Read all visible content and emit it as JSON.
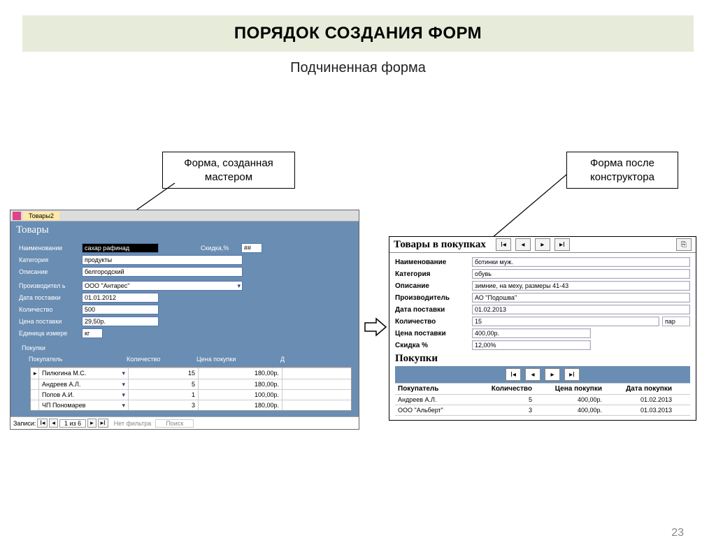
{
  "title": "ПОРЯДОК СОЗДАНИЯ ФОРМ",
  "subtitle": "Подчиненная форма",
  "callout_left": "Форма, созданная мастером",
  "callout_right": "Форма после конструктора",
  "page_number": "23",
  "left_form": {
    "tab": "Товары2",
    "header": "Товары",
    "fields": {
      "name_label": "Наименование",
      "name_value": "сахар рафинад",
      "cat_label": "Категория",
      "cat_value": "продукты",
      "desc_label": "Описание",
      "desc_value": "белгородский",
      "maker_label": "Производител ь",
      "maker_value": "ООО \"Антарес\"",
      "date_label": "Дата поставки",
      "date_value": "01.01.2012",
      "qty_label": "Количество",
      "qty_value": "500",
      "price_label": "Цена поставки",
      "price_value": "29,50р.",
      "unit_label": "Единица измере",
      "unit_value": "кг",
      "discount_label": "Скидка,%"
    },
    "sub_header": "Покупки",
    "columns": {
      "buyer": "Покупатель",
      "qty": "Количество",
      "price": "Цена покупки",
      "d": "Д"
    },
    "rows": [
      {
        "buyer": "Пилюгина М.С.",
        "qty": "15",
        "price": "180,00р."
      },
      {
        "buyer": "Андреев А.Л.",
        "qty": "5",
        "price": "180,00р."
      },
      {
        "buyer": "Попов А.И.",
        "qty": "1",
        "price": "100,00р."
      },
      {
        "buyer": "ЧП Пономарев",
        "qty": "3",
        "price": "180,00р."
      }
    ],
    "recnav": {
      "label": "Записи:",
      "pos": "1 из 6",
      "filter": "Нет фильтра",
      "search": "Поиск"
    }
  },
  "right_form": {
    "header": "Товары в покупках",
    "fields": {
      "name_label": "Наименование",
      "name_value": "ботинки муж.",
      "cat_label": "Категория",
      "cat_value": "обувь",
      "desc_label": "Описание",
      "desc_value": "зимние, на меху, размеры 41-43",
      "maker_label": "Производитель",
      "maker_value": "АО \"Подошва\"",
      "date_label": "Дата поставки",
      "date_value": "01.02.2013",
      "qty_label": "Количество",
      "qty_value": "15",
      "qty_unit": "пар",
      "price_label": "Цена поставки",
      "price_value": "400,00р.",
      "disc_label": "Скидка %",
      "disc_value": "12,00%"
    },
    "sub_header": "Покупки",
    "columns": {
      "buyer": "Покупатель",
      "qty": "Количество",
      "price": "Цена покупки",
      "date": "Дата покупки"
    },
    "rows": [
      {
        "buyer": "Андреев А.Л.",
        "qty": "5",
        "price": "400,00р.",
        "date": "01.02.2013"
      },
      {
        "buyer": "ООО \"Альберт\"",
        "qty": "3",
        "price": "400,00р.",
        "date": "01.03.2013"
      }
    ]
  }
}
